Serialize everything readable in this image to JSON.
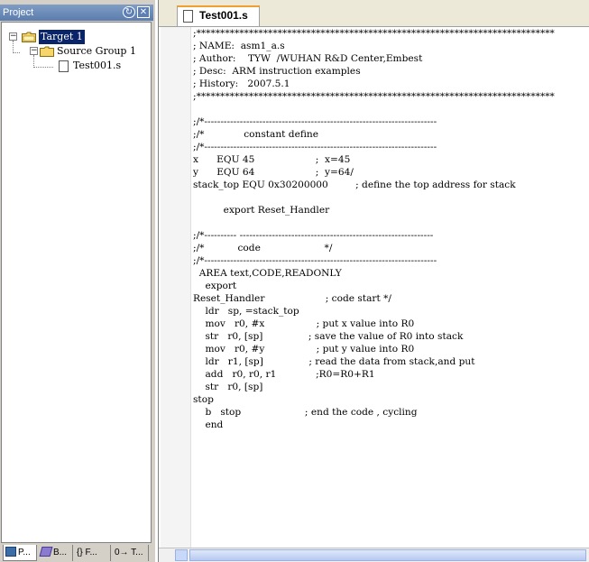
{
  "project_panel": {
    "title": "Project",
    "pin_glyph": "↻",
    "close_glyph": "✕",
    "tree": {
      "target": "Target 1",
      "group": "Source Group 1",
      "file": "Test001.s",
      "expander_minus": "−"
    },
    "tabs": [
      {
        "label": "P..."
      },
      {
        "label": "B..."
      },
      {
        "label": "{} F..."
      },
      {
        "label": "0→ T..."
      }
    ]
  },
  "editor": {
    "tab_label": "Test001.s",
    "code_lines": [
      ";***************************************************************************",
      "; NAME:  asm1_a.s",
      "; Author:    TYW  /WUHAN R&D Center,Embest",
      "; Desc:  ARM instruction examples",
      "; History:   2007.5.1",
      ";***************************************************************************",
      "",
      ";/*------------------------------------------------------------------------",
      ";/*             constant define",
      ";/*------------------------------------------------------------------------",
      "x      EQU 45                    ;  x=45",
      "y      EQU 64                    ;  y=64/",
      "stack_top EQU 0x30200000         ; define the top address for stack",
      "",
      "          export Reset_Handler",
      "",
      ";/*---------- ------------------------------------------------------------",
      ";/*           code                     */",
      ";/*------------------------------------------------------------------------",
      "  AREA text,CODE,READONLY",
      "    export",
      "Reset_Handler                    ; code start */",
      "    ldr   sp, =stack_top",
      "    mov   r0, #x                 ; put x value into R0",
      "    str   r0, [sp]               ; save the value of R0 into stack",
      "    mov   r0, #y                 ; put y value into R0",
      "    ldr   r1, [sp]               ; read the data from stack,and put",
      "    add   r0, r0, r1             ;R0=R0+R1",
      "    str   r0, [sp]",
      "stop",
      "    b   stop                     ; end the code , cycling",
      "    end"
    ]
  },
  "colors": {
    "selection": "#0a246a",
    "tab_accent": "#f0a030",
    "title_bar": "#6b8cbf"
  }
}
